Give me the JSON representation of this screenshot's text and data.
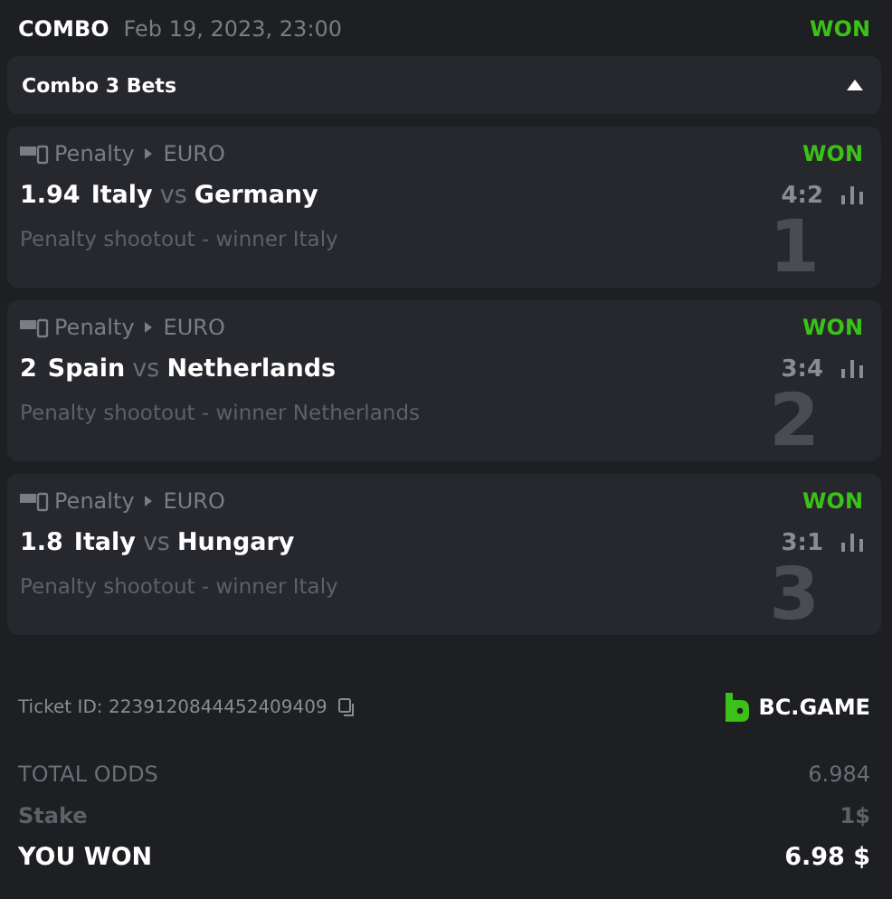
{
  "header": {
    "type": "COMBO",
    "date": "Feb 19, 2023, 23:00",
    "status": "WON"
  },
  "combo": {
    "title": "Combo 3 Bets",
    "expanded": true
  },
  "bets": [
    {
      "index": "1",
      "category": "Penalty",
      "league": "EURO",
      "status": "WON",
      "odds": "1.94",
      "home": "Italy",
      "vs": "vs",
      "away": "Germany",
      "score": "4:2",
      "market": "Penalty shootout - winner Italy"
    },
    {
      "index": "2",
      "category": "Penalty",
      "league": "EURO",
      "status": "WON",
      "odds": "2",
      "home": "Spain",
      "vs": "vs",
      "away": "Netherlands",
      "score": "3:4",
      "market": "Penalty shootout - winner Netherlands"
    },
    {
      "index": "3",
      "category": "Penalty",
      "league": "EURO",
      "status": "WON",
      "odds": "1.8",
      "home": "Italy",
      "vs": "vs",
      "away": "Hungary",
      "score": "3:1",
      "market": "Penalty shootout - winner Italy"
    }
  ],
  "ticket": {
    "label": "Ticket ID:",
    "id": "2239120844452409409"
  },
  "brand": "BC.GAME",
  "totals": [
    {
      "kind": "odds",
      "label": "TOTAL ODDS",
      "value": "6.984"
    },
    {
      "kind": "stake",
      "label": "Stake",
      "value": "1$"
    },
    {
      "kind": "win",
      "label": "YOU WON",
      "value": "6.98 $"
    }
  ]
}
